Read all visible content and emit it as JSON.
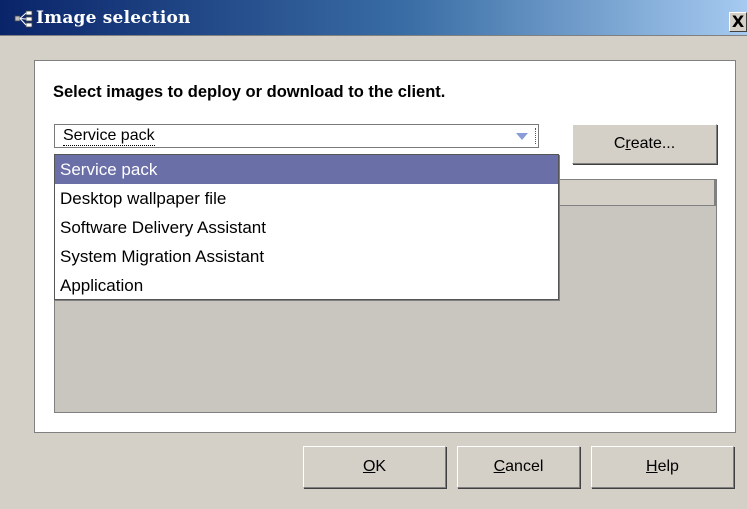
{
  "window": {
    "title": "Image selection",
    "close_label": "X"
  },
  "instruction": "Select images to deploy or download to the client.",
  "combo": {
    "selected": "Service pack"
  },
  "create_button": {
    "pre": "C",
    "mn": "r",
    "post": "eate..."
  },
  "dropdown": {
    "items": [
      {
        "label": "Service pack",
        "selected": true
      },
      {
        "label": "Desktop wallpaper file"
      },
      {
        "label": "Software Delivery Assistant"
      },
      {
        "label": "System Migration Assistant"
      },
      {
        "label": "Application"
      }
    ]
  },
  "buttons": {
    "ok": {
      "mn": "O",
      "post": "K"
    },
    "cancel": {
      "mn": "C",
      "post": "ancel"
    },
    "help": {
      "mn": "H",
      "post": "elp"
    }
  },
  "colors": {
    "titlebar_start": "#0a246a",
    "titlebar_end": "#a6caf0",
    "selection": "#6b6fa8",
    "dialog_face": "#d4d0c8"
  },
  "icons": {
    "title_icon": "network-nodes-icon",
    "combo_arrow": "chevron-down-icon"
  }
}
